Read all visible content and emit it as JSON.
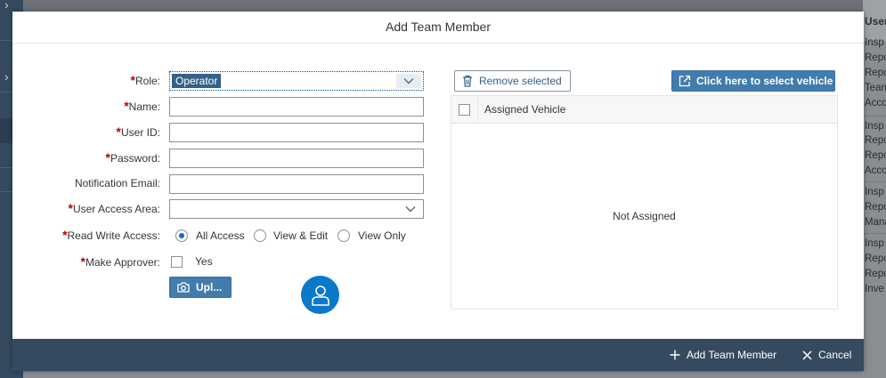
{
  "background": {
    "right_panel": {
      "header": "User",
      "lines": [
        "Insp",
        "Repo",
        "Repo",
        "Tean",
        "Acco",
        "Insp",
        "Repo",
        "Repo",
        "Acco",
        "Insp",
        "Repo",
        "Mana",
        "Insp",
        "Repo",
        "Repo",
        "Inve"
      ]
    }
  },
  "dialog": {
    "title": "Add Team Member",
    "form": {
      "role": {
        "label": "Role:",
        "value": "Operator"
      },
      "name": {
        "label": "Name:",
        "value": ""
      },
      "user_id": {
        "label": "User ID:",
        "value": ""
      },
      "password": {
        "label": "Password:",
        "value": ""
      },
      "notification_email": {
        "label": "Notification Email:",
        "value": ""
      },
      "user_access_area": {
        "label": "User Access Area:",
        "value": ""
      },
      "read_write_access": {
        "label": "Read Write Access:",
        "options": [
          "All Access",
          "View & Edit",
          "View Only"
        ],
        "selected": "All Access"
      },
      "make_approver": {
        "label": "Make Approver:",
        "option": "Yes",
        "checked": false
      },
      "upload_label": "Upl..."
    },
    "vehicles": {
      "remove_label": "Remove selected",
      "select_label": "Click here to select vehicle",
      "column_header": "Assigned Vehicle",
      "empty_text": "Not Assigned"
    },
    "footer": {
      "add_label": "Add Team Member",
      "cancel_label": "Cancel"
    }
  },
  "colors": {
    "accent": "#427cac",
    "required": "#bb0000",
    "footer_bg": "#354a5f",
    "avatar": "#0a79c9"
  }
}
